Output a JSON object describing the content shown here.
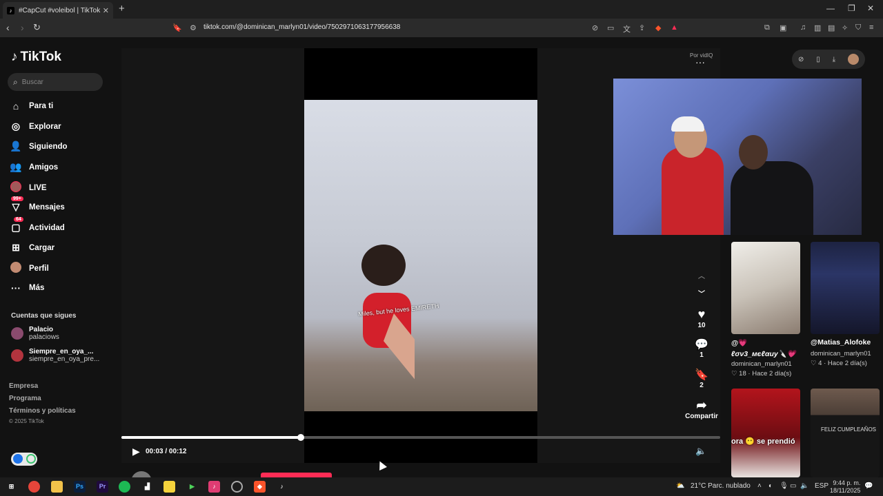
{
  "browser": {
    "tab_title": "#CapCut #voleibol | TikTok",
    "url": "tiktok.com/@dominican_marlyn01/video/7502971063177956638"
  },
  "sidebar": {
    "logo": "TikTok",
    "search_placeholder": "Buscar",
    "items": [
      {
        "label": "Para ti",
        "icon": "home-icon"
      },
      {
        "label": "Explorar",
        "icon": "compass-icon"
      },
      {
        "label": "Siguiendo",
        "icon": "following-icon"
      },
      {
        "label": "Amigos",
        "icon": "friends-icon"
      },
      {
        "label": "LIVE",
        "icon": "live-icon"
      },
      {
        "label": "Mensajes",
        "icon": "messages-icon",
        "badge": "99+"
      },
      {
        "label": "Actividad",
        "icon": "activity-icon",
        "badge": "64"
      },
      {
        "label": "Cargar",
        "icon": "upload-icon"
      },
      {
        "label": "Perfil",
        "icon": "profile-icon"
      },
      {
        "label": "Más",
        "icon": "more-icon"
      }
    ],
    "following_title": "Cuentas que sigues",
    "following": [
      {
        "name": "Palacio",
        "handle": "palaciows"
      },
      {
        "name": "Siempre_en_oya_...",
        "handle": "siempre_en_oya_pre..."
      }
    ],
    "footer_links": [
      "Empresa",
      "Programa",
      "Términos y políticas"
    ],
    "copyright": "© 2025 TikTok"
  },
  "video": {
    "caption": "Miles, but he loves EMIRETH",
    "por_vidiq": "Por vidIQ",
    "likes": "10",
    "comments": "1",
    "saves": "2",
    "share_label": "Compartir",
    "time": "00:03 / 00:12",
    "progress_fraction": 0.3,
    "author": "dominican_marlyn01"
  },
  "suggestions": [
    {
      "title": "@💗",
      "line2": "ℓσν3_мєℓαиу🔪💗",
      "user": "dominican_marlyn01",
      "likes": "18",
      "when": "Hace 2 día(s)"
    },
    {
      "title": "@Matias_Alofoke",
      "user": "dominican_marlyn01",
      "likes": "4",
      "when": "Hace 2 día(s)"
    },
    {
      "overlay": "ora 😶 se prendió"
    },
    {
      "overlay": "FELIZ CUMPLEAÑOS"
    }
  ],
  "taskbar": {
    "weather": "21°C  Parc. nublado",
    "lang": "ESP",
    "time": "9:44 p. m.",
    "date": "18/11/2025"
  },
  "colors": {
    "accent": "#fe2c55",
    "bg": "#121212"
  }
}
